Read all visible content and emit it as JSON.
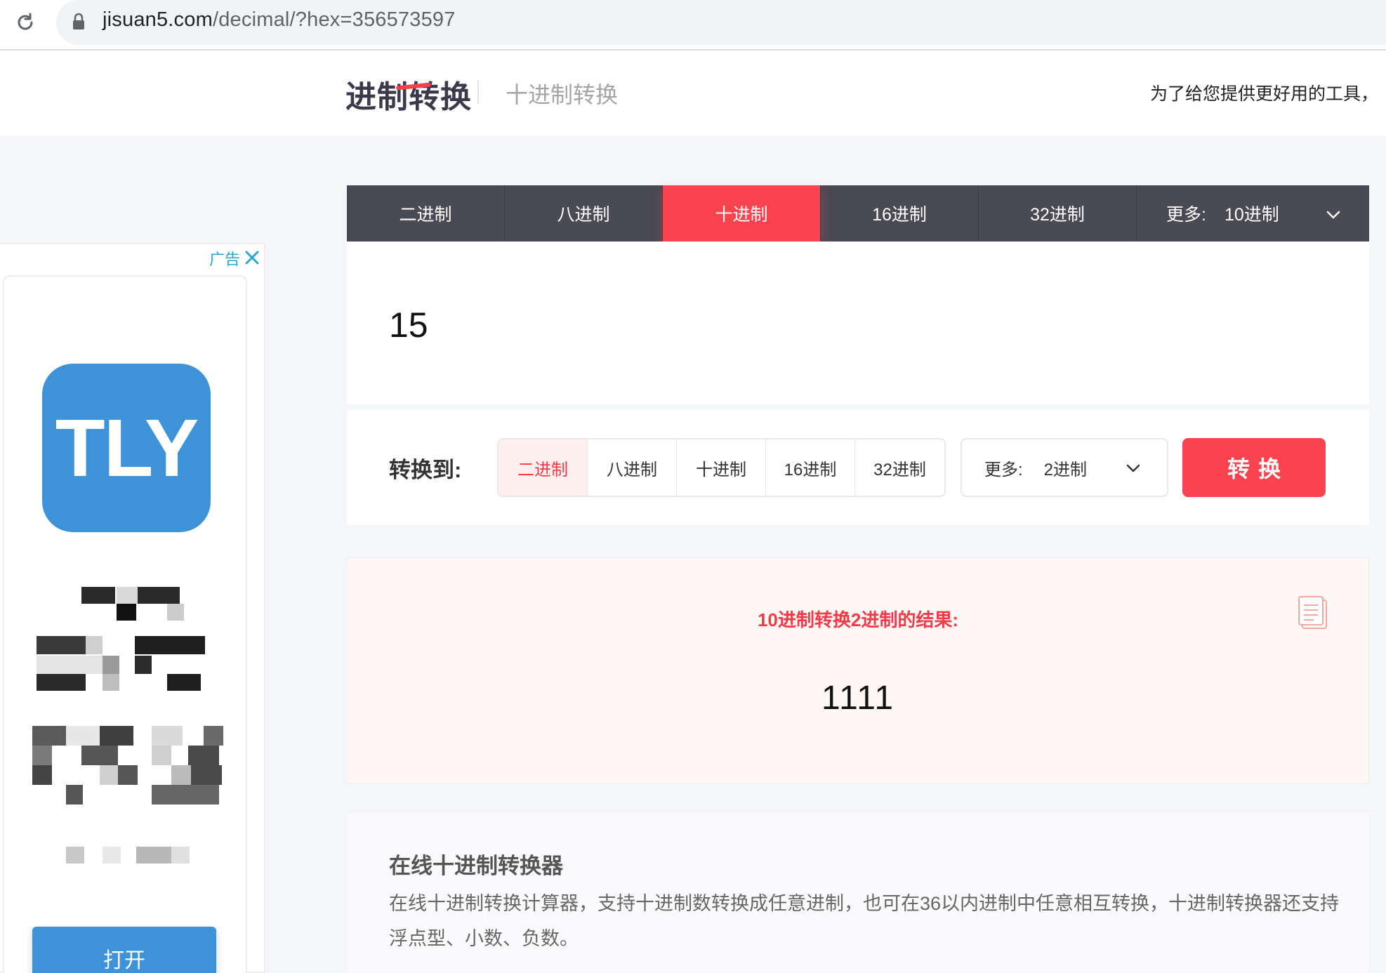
{
  "browser": {
    "url_host": "jisuan5.com",
    "url_path": "/decimal/?hex=356573597"
  },
  "header": {
    "logo": "进制转换",
    "subtitle": "十进制转换",
    "note": "为了给您提供更好用的工具，"
  },
  "ad": {
    "tag": "广告",
    "logo_text": "TLY",
    "open_label": "打开"
  },
  "source_tabs": [
    {
      "label": "二进制"
    },
    {
      "label": "八进制"
    },
    {
      "label": "十进制"
    },
    {
      "label": "16进制"
    },
    {
      "label": "32进制"
    }
  ],
  "source_more": {
    "label": "更多:",
    "value": "10进制"
  },
  "input": {
    "value": "15"
  },
  "convert": {
    "label": "转换到:",
    "targets": [
      {
        "label": "二进制"
      },
      {
        "label": "八进制"
      },
      {
        "label": "十进制"
      },
      {
        "label": "16进制"
      },
      {
        "label": "32进制"
      }
    ],
    "more_label": "更多:",
    "more_value": "2进制",
    "button_label": "转换"
  },
  "result": {
    "title": "10进制转换2进制的结果:",
    "value": "1111"
  },
  "info": {
    "title": "在线十进制转换器",
    "text": "在线十进制转换计算器，支持十进制数转换成任意进制，也可在36以内进制中任意相互转换，十进制转换器还支持浮点型、小数、负数。"
  },
  "colors": {
    "accent": "#f9434e",
    "tab_bg": "#4a4a54",
    "ad_blue": "#3d92d8"
  }
}
